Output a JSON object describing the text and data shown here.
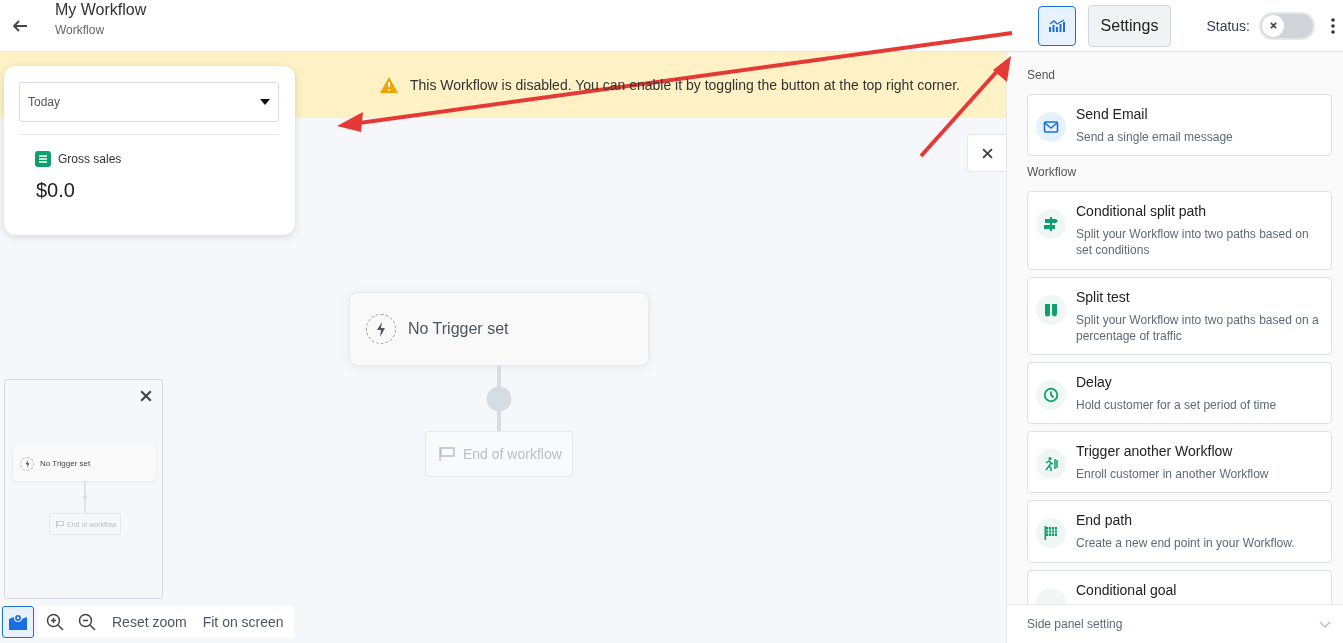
{
  "header": {
    "title": "My Workflow",
    "subtitle": "Workflow"
  },
  "toolbar": {
    "analytics_selected": true,
    "settings_label": "Settings",
    "status_label": "Status:",
    "status_on": false
  },
  "banner": {
    "text": "This Workflow is disabled. You can enable it by toggling the button at the top right corner."
  },
  "stats_card": {
    "period": "Today",
    "metric_label": "Gross sales",
    "metric_value": "$0.0"
  },
  "canvas": {
    "trigger": "No Trigger set",
    "end": "End of workflow"
  },
  "minimap": {
    "trigger": "No Trigger set",
    "end": "End of workflow"
  },
  "zoom_controls": {
    "minimap_selected": true,
    "reset": "Reset zoom",
    "fit": "Fit on screen"
  },
  "side_panel": {
    "sections": [
      {
        "title": "Send",
        "items": [
          {
            "kind": "email",
            "title": "Send Email",
            "description": "Send a single email message"
          }
        ]
      },
      {
        "title": "Workflow",
        "items": [
          {
            "kind": "split",
            "title": "Conditional split path",
            "description": "Split your Workflow into two paths based on set conditions"
          },
          {
            "kind": "splittest",
            "title": "Split test",
            "description": "Split your Workflow into two paths based on a percentage of traffic"
          },
          {
            "kind": "delay",
            "title": "Delay",
            "description": "Hold customer for a set period of time"
          },
          {
            "kind": "trigger",
            "title": "Trigger another Workflow",
            "description": "Enroll customer in another Workflow"
          },
          {
            "kind": "end",
            "title": "End path",
            "description": "Create a new end point in your Workflow."
          },
          {
            "kind": "goal",
            "title": "Conditional goal"
          }
        ]
      }
    ],
    "footer": "Side panel setting"
  }
}
